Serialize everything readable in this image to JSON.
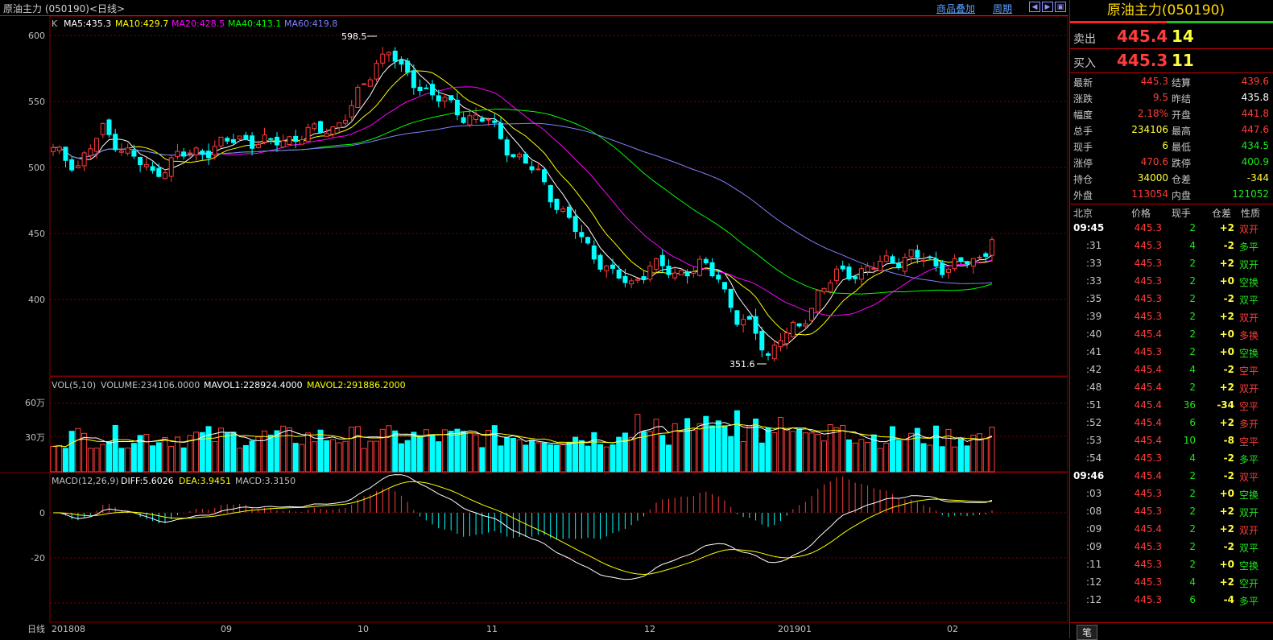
{
  "header": {
    "title": "原油主力 (050190)<日线>",
    "overlay_label": "商品叠加",
    "period_label": "周期",
    "nav_buttons": [
      "◀",
      "▶",
      "▣"
    ]
  },
  "main_chart": {
    "ma_label_k": "K",
    "ma_values": [
      {
        "text": "MA5:435.3",
        "color": "#ffffff"
      },
      {
        "text": "MA10:429.7",
        "color": "#ffff00"
      },
      {
        "text": "MA20:428.5",
        "color": "#ff00ff"
      },
      {
        "text": "MA40:413.1",
        "color": "#00ff00"
      },
      {
        "text": "MA60:419.8",
        "color": "#8080ff"
      }
    ],
    "high_label": "598.5",
    "low_label": "351.6",
    "y_ticks": [
      "600",
      "550",
      "500",
      "450",
      "400"
    ]
  },
  "volume_chart": {
    "label": "VOL(5,10)",
    "volume": "VOLUME:234106.0000",
    "mavol1": "MAVOL1:228924.4000",
    "mavol2": "MAVOL2:291886.2000",
    "y_ticks": [
      "60万",
      "30万"
    ]
  },
  "macd_chart": {
    "label": "MACD(12,26,9)",
    "diff": "DIFF:5.6026",
    "dea": "DEA:3.9451",
    "macd": "MACD:3.3150",
    "y_ticks": [
      "0",
      "-20"
    ]
  },
  "x_axis": {
    "corner_label": "日线",
    "labels": [
      "201808",
      "09",
      "10",
      "11",
      "12",
      "201901",
      "02"
    ]
  },
  "colors": {
    "up": "#ff3c3c",
    "down": "#00ffff",
    "grid": "#800000",
    "ma5": "#ffffff",
    "ma10": "#ffff00",
    "ma20": "#ff00ff",
    "ma40": "#00ff00",
    "ma60": "#8080ff"
  },
  "chart_data": {
    "type": "candlestick",
    "close_anchors": [
      {
        "x": 0,
        "v": 512
      },
      {
        "x": 4,
        "v": 502
      },
      {
        "x": 8,
        "v": 528
      },
      {
        "x": 10,
        "v": 520
      },
      {
        "x": 13,
        "v": 507
      },
      {
        "x": 16,
        "v": 495
      },
      {
        "x": 20,
        "v": 508
      },
      {
        "x": 25,
        "v": 514
      },
      {
        "x": 30,
        "v": 522
      },
      {
        "x": 35,
        "v": 518
      },
      {
        "x": 40,
        "v": 525
      },
      {
        "x": 45,
        "v": 530
      },
      {
        "x": 48,
        "v": 545
      },
      {
        "x": 52,
        "v": 580
      },
      {
        "x": 54,
        "v": 590
      },
      {
        "x": 56,
        "v": 572
      },
      {
        "x": 59,
        "v": 562
      },
      {
        "x": 62,
        "v": 552
      },
      {
        "x": 66,
        "v": 540
      },
      {
        "x": 70,
        "v": 535
      },
      {
        "x": 74,
        "v": 510
      },
      {
        "x": 78,
        "v": 495
      },
      {
        "x": 82,
        "v": 465
      },
      {
        "x": 86,
        "v": 440
      },
      {
        "x": 90,
        "v": 418
      },
      {
        "x": 93,
        "v": 412
      },
      {
        "x": 96,
        "v": 426
      },
      {
        "x": 100,
        "v": 420
      },
      {
        "x": 104,
        "v": 425
      },
      {
        "x": 107,
        "v": 418
      },
      {
        "x": 110,
        "v": 385
      },
      {
        "x": 113,
        "v": 375
      },
      {
        "x": 115,
        "v": 358
      },
      {
        "x": 117,
        "v": 372
      },
      {
        "x": 120,
        "v": 378
      },
      {
        "x": 123,
        "v": 405
      },
      {
        "x": 126,
        "v": 418
      },
      {
        "x": 130,
        "v": 422
      },
      {
        "x": 134,
        "v": 428
      },
      {
        "x": 138,
        "v": 434
      },
      {
        "x": 142,
        "v": 425
      },
      {
        "x": 146,
        "v": 427
      },
      {
        "x": 149,
        "v": 430
      },
      {
        "x": 151,
        "v": 445.3
      }
    ],
    "y_range": [
      340,
      610
    ],
    "volume_range": [
      0,
      700000
    ],
    "macd_range": [
      -32,
      22
    ],
    "bars": 152
  },
  "quote_panel": {
    "title": "原油主力(050190)",
    "sell_label": "卖出",
    "sell_price": "445.4",
    "sell_qty": "14",
    "buy_label": "买入",
    "buy_price": "445.3",
    "buy_qty": "11",
    "stats": [
      {
        "l1": "最新",
        "v1": "445.3",
        "c1": "red",
        "l2": "结算",
        "v2": "439.6",
        "c2": "red"
      },
      {
        "l1": "涨跌",
        "v1": "9.5",
        "c1": "red",
        "l2": "昨结",
        "v2": "435.8",
        "c2": "wht"
      },
      {
        "l1": "幅度",
        "v1": "2.18%",
        "c1": "red",
        "l2": "开盘",
        "v2": "441.8",
        "c2": "red"
      },
      {
        "l1": "总手",
        "v1": "234106",
        "c1": "yel",
        "l2": "最高",
        "v2": "447.6",
        "c2": "red"
      },
      {
        "l1": "现手",
        "v1": "6",
        "c1": "yel",
        "l2": "最低",
        "v2": "434.5",
        "c2": "grn"
      },
      {
        "l1": "涨停",
        "v1": "470.6",
        "c1": "red",
        "l2": "跌停",
        "v2": "400.9",
        "c2": "grn"
      },
      {
        "l1": "持仓",
        "v1": "34000",
        "c1": "yel",
        "l2": "仓差",
        "v2": "-344",
        "c2": "yel"
      },
      {
        "l1": "外盘",
        "v1": "113054",
        "c1": "red",
        "l2": "内盘",
        "v2": "121052",
        "c2": "grn"
      }
    ],
    "tick_headers": [
      "北京",
      "价格",
      "现手",
      "仓差",
      "性质"
    ],
    "ticks": [
      {
        "t": "09:45",
        "p": "445.3",
        "q": "2",
        "d": "+2",
        "n": "双开",
        "nc": "red",
        "bold": true
      },
      {
        "t": ":31",
        "p": "445.3",
        "q": "4",
        "d": "-2",
        "n": "多平",
        "nc": "grn",
        "bold": false
      },
      {
        "t": ":33",
        "p": "445.3",
        "q": "2",
        "d": "+2",
        "n": "双开",
        "nc": "grn",
        "bold": false
      },
      {
        "t": ":33",
        "p": "445.3",
        "q": "2",
        "d": "+0",
        "n": "空换",
        "nc": "grn",
        "bold": false
      },
      {
        "t": ":35",
        "p": "445.3",
        "q": "2",
        "d": "-2",
        "n": "双平",
        "nc": "grn",
        "bold": false
      },
      {
        "t": ":39",
        "p": "445.3",
        "q": "2",
        "d": "+2",
        "n": "双开",
        "nc": "red",
        "bold": false
      },
      {
        "t": ":40",
        "p": "445.4",
        "q": "2",
        "d": "+0",
        "n": "多换",
        "nc": "red",
        "bold": false
      },
      {
        "t": ":41",
        "p": "445.3",
        "q": "2",
        "d": "+0",
        "n": "空换",
        "nc": "grn",
        "bold": false
      },
      {
        "t": ":42",
        "p": "445.4",
        "q": "4",
        "d": "-2",
        "n": "空平",
        "nc": "red",
        "bold": false
      },
      {
        "t": ":48",
        "p": "445.4",
        "q": "2",
        "d": "+2",
        "n": "双开",
        "nc": "red",
        "bold": false
      },
      {
        "t": ":51",
        "p": "445.4",
        "q": "36",
        "d": "-34",
        "n": "空平",
        "nc": "red",
        "bold": false
      },
      {
        "t": ":52",
        "p": "445.4",
        "q": "6",
        "d": "+2",
        "n": "多开",
        "nc": "red",
        "bold": false
      },
      {
        "t": ":53",
        "p": "445.4",
        "q": "10",
        "d": "-8",
        "n": "空平",
        "nc": "red",
        "bold": false
      },
      {
        "t": ":54",
        "p": "445.3",
        "q": "4",
        "d": "-2",
        "n": "多平",
        "nc": "grn",
        "bold": false
      },
      {
        "t": "09:46",
        "p": "445.4",
        "q": "2",
        "d": "-2",
        "n": "双平",
        "nc": "red",
        "bold": true
      },
      {
        "t": ":03",
        "p": "445.3",
        "q": "2",
        "d": "+0",
        "n": "空换",
        "nc": "grn",
        "bold": false
      },
      {
        "t": ":08",
        "p": "445.3",
        "q": "2",
        "d": "+2",
        "n": "双开",
        "nc": "grn",
        "bold": false
      },
      {
        "t": ":09",
        "p": "445.4",
        "q": "2",
        "d": "+2",
        "n": "双开",
        "nc": "red",
        "bold": false
      },
      {
        "t": ":09",
        "p": "445.3",
        "q": "2",
        "d": "-2",
        "n": "双平",
        "nc": "grn",
        "bold": false
      },
      {
        "t": ":11",
        "p": "445.3",
        "q": "2",
        "d": "+0",
        "n": "空换",
        "nc": "grn",
        "bold": false
      },
      {
        "t": ":12",
        "p": "445.3",
        "q": "4",
        "d": "+2",
        "n": "空开",
        "nc": "grn",
        "bold": false
      },
      {
        "t": ":12",
        "p": "445.3",
        "q": "6",
        "d": "-4",
        "n": "多平",
        "nc": "grn",
        "bold": false
      }
    ],
    "bottom_tab": "笔"
  }
}
